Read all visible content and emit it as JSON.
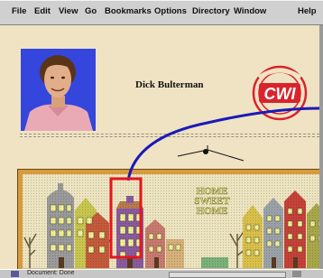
{
  "menubar": {
    "items": [
      "File",
      "Edit",
      "View",
      "Go",
      "Bookmarks",
      "Options",
      "Directory",
      "Window",
      "Help"
    ]
  },
  "page": {
    "person_name": "Dick Bulterman",
    "logo_text": "CWI",
    "town_sign": [
      "HOME",
      "SWEET",
      "HOME"
    ]
  },
  "status": {
    "text": "Document: Done"
  },
  "colors": {
    "link_curve": "#1a1ab8",
    "selection_box": "#e8141c",
    "logo_red": "#d8242c"
  }
}
